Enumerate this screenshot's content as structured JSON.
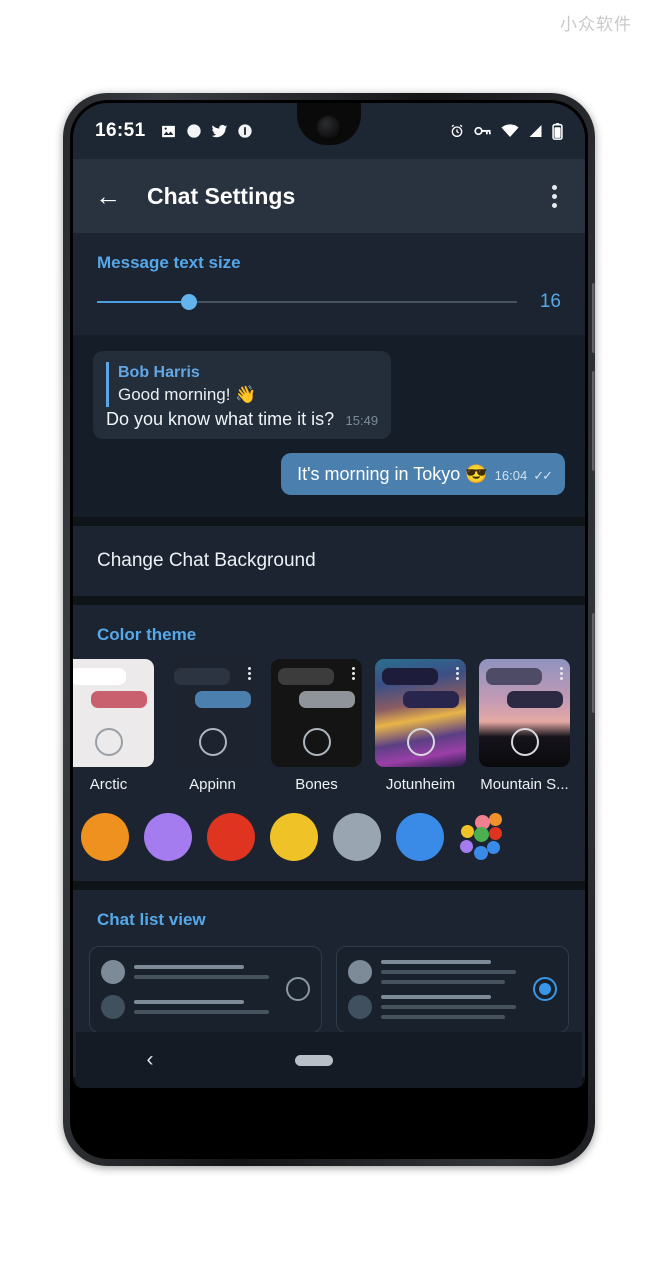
{
  "watermark": "小众软件",
  "status_bar": {
    "time": "16:51",
    "left_icons": [
      "image-icon",
      "circle-icon",
      "twitter-icon",
      "info-app-icon"
    ],
    "right_icons": [
      "alarm-icon",
      "vpn-key-icon",
      "wifi-icon",
      "signal-icon",
      "battery-icon"
    ]
  },
  "app_bar": {
    "back_label": "←",
    "title": "Chat Settings",
    "overflow_label": "⋮"
  },
  "text_size": {
    "header": "Message text size",
    "value": "16",
    "percent": 22
  },
  "chat_preview": {
    "incoming": {
      "reply_name": "Bob Harris",
      "reply_text": "Good morning! 👋",
      "text": "Do you know what time it is?",
      "time": "15:49"
    },
    "outgoing": {
      "text": "It's morning in Tokyo 😎",
      "time": "16:04",
      "ticks": "✓✓"
    }
  },
  "background_row": {
    "label": "Change Chat Background"
  },
  "color_theme": {
    "header": "Color theme",
    "themes": [
      {
        "name": "Arctic",
        "bg": "#eceaea",
        "in_bubble": "#ffffff",
        "out_bubble": "#c9606d",
        "circle": "#9aa0a6",
        "dots": false,
        "scene": "none"
      },
      {
        "name": "Appinn",
        "bg": "#1d2430",
        "in_bubble": "#2b3440",
        "out_bubble": "#4a7fae",
        "circle": "#aeb6be",
        "dots": true,
        "scene": "none"
      },
      {
        "name": "Bones",
        "bg": "#141414",
        "in_bubble": "#3c3c3c",
        "out_bubble": "#8e9499",
        "circle": "#aeb6be",
        "dots": true,
        "scene": "none"
      },
      {
        "name": "Jotunheim",
        "bg": "#2a2150",
        "in_bubble": "#1d1c3a",
        "out_bubble": "#28264d",
        "circle": "#d7dade",
        "dots": true,
        "scene": "aurora"
      },
      {
        "name": "Mountain S...",
        "bg": "#c6a0b4",
        "in_bubble": "#4e4b66",
        "out_bubble": "#2b2a42",
        "circle": "#d7dade",
        "dots": true,
        "scene": "mountain"
      }
    ],
    "swatches": [
      {
        "name": "orange",
        "color": "#ef911f"
      },
      {
        "name": "purple",
        "color": "#a57cf0"
      },
      {
        "name": "red",
        "color": "#df3520"
      },
      {
        "name": "yellow",
        "color": "#efc227"
      },
      {
        "name": "gray-blue",
        "color": "#9aa5b2"
      },
      {
        "name": "blue",
        "color": "#3a8ae8"
      }
    ],
    "custom_picker": {
      "name": "custom-color-picker",
      "colors": [
        "#f0808f",
        "#f2922c",
        "#efc227",
        "#df3520",
        "#4caf50",
        "#a57cf0",
        "#3a8ae8"
      ]
    }
  },
  "chat_list_view": {
    "header": "Chat list view",
    "options": [
      {
        "name": "Two lines",
        "selected": false
      },
      {
        "name": "Three lines",
        "selected": true
      }
    ]
  },
  "nav_bar": {
    "back": "‹",
    "home_pill": "home-pill"
  },
  "colors": {
    "accent": "#3a8ae8",
    "header_blue": "#56a8e8",
    "screen_bg": "#0f1419",
    "section_bg": "#1b2430",
    "appbar_bg": "#28333f",
    "statusbar_bg": "#1d2733"
  }
}
